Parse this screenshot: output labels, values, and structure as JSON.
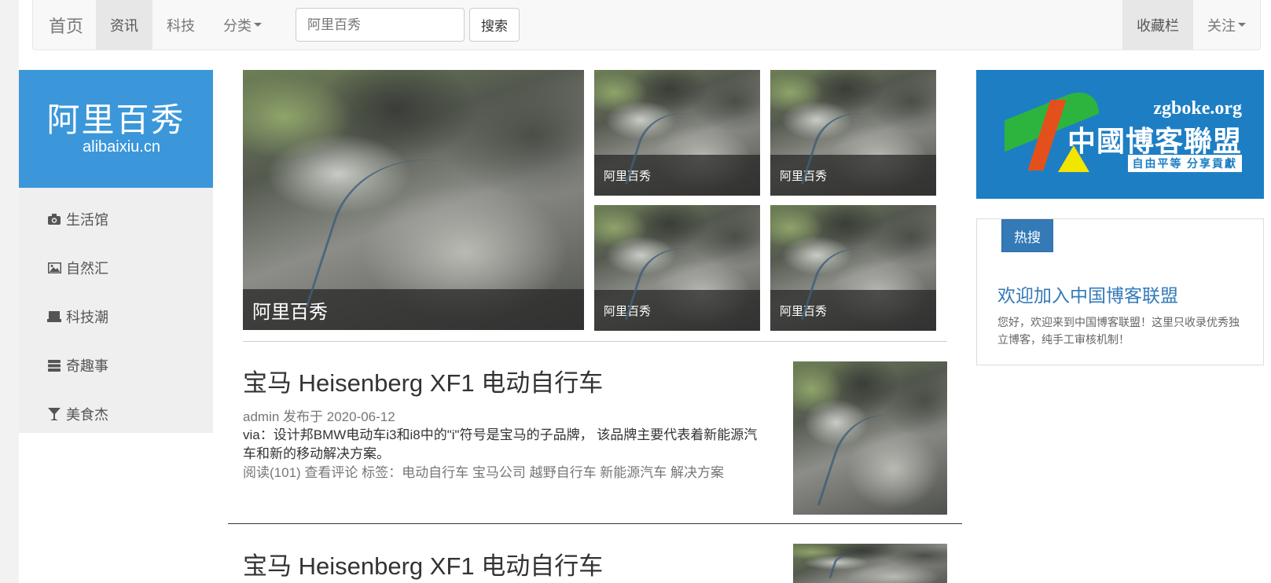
{
  "navbar": {
    "brand": "首页",
    "items": [
      {
        "label": "资讯"
      },
      {
        "label": "科技"
      },
      {
        "label": "分类"
      }
    ],
    "search": {
      "placeholder": "阿里百秀",
      "button": "搜索"
    },
    "right": [
      {
        "label": "收藏栏"
      },
      {
        "label": "关注"
      }
    ]
  },
  "sidebar": {
    "logo_cn": "阿里百秀",
    "logo_en": "alibaixiu.cn",
    "items": [
      {
        "label": "生活馆",
        "icon": "camera-icon"
      },
      {
        "label": "自然汇",
        "icon": "picture-icon"
      },
      {
        "label": "科技潮",
        "icon": "laptop-icon"
      },
      {
        "label": "奇趣事",
        "icon": "server-icon"
      },
      {
        "label": "美食杰",
        "icon": "glass-icon"
      }
    ]
  },
  "carousel": {
    "main_caption": "阿里百秀",
    "tiles": [
      {
        "caption": "阿里百秀"
      },
      {
        "caption": "阿里百秀"
      },
      {
        "caption": "阿里百秀"
      },
      {
        "caption": "阿里百秀"
      }
    ]
  },
  "articles": [
    {
      "title": "宝马 Heisenberg XF1 电动自行车",
      "meta": "admin 发布于 2020-06-12",
      "excerpt": "via：设计邦BMW电动车i3和i8中的\"i\"符号是宝马的子品牌， 该品牌主要代表着新能源汽车和新的移动解决方案。",
      "footer": "阅读(101) 查看评论 标签：电动自行车 宝马公司 越野自行车 新能源汽车 解决方案"
    },
    {
      "title": "宝马 Heisenberg XF1 电动自行车"
    }
  ],
  "banner": {
    "url": "zgboke.org",
    "name": "中國博客聯盟",
    "slogan": "自由平等 分享貢獻"
  },
  "hot": {
    "tab": "热搜",
    "title": "欢迎加入中国博客联盟",
    "desc": "您好，欢迎来到中国博客联盟！这里只收录优秀独立博客，纯手工审核机制！"
  },
  "colors": {
    "accent": "#337ab7",
    "logo_bg": "#3b97d9",
    "banner_bg": "#1d7ec4"
  }
}
